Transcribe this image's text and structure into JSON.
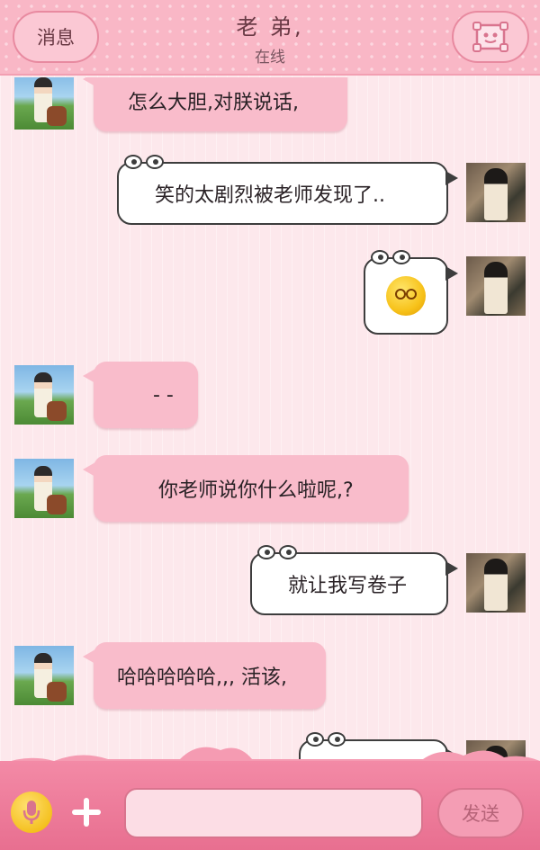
{
  "header": {
    "back_label": "消息",
    "title": "老 弟,",
    "status": "在线",
    "menu_icon": "profile-face-icon"
  },
  "messages": [
    {
      "side": "in",
      "text": "怎么大胆,对朕说话,"
    },
    {
      "side": "out",
      "text": "笑的太剧烈被老师发现了.."
    },
    {
      "side": "out",
      "type": "emoji",
      "emoji": "worried-face-emoji"
    },
    {
      "side": "in",
      "text": "- -"
    },
    {
      "side": "in",
      "text": "你老师说你什么啦呢,?"
    },
    {
      "side": "out",
      "text": "就让我写卷子"
    },
    {
      "side": "in",
      "text": "哈哈哈哈哈,,, 活该,"
    },
    {
      "side": "out",
      "text": ""
    }
  ],
  "composer": {
    "mic_icon": "microphone-icon",
    "plus_icon": "plus-icon",
    "input_value": "",
    "send_label": "发送"
  },
  "colors": {
    "header_bg": "#f9b7c6",
    "incoming_bubble": "#f9bccb",
    "outgoing_bubble": "#ffffff",
    "bottom_bar": "#e86f90",
    "mic": "#f0b400"
  }
}
